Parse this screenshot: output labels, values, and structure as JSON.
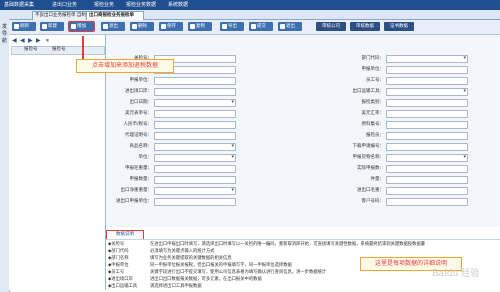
{
  "topbar": {
    "items": [
      "基础数据采集",
      "进出口业务",
      "报检业务",
      "报检业务数据",
      "系统数据"
    ]
  },
  "tabs": [
    {
      "label": "不良出口业务报检单 自制"
    },
    {
      "label": "出口商报检业务报检单"
    }
  ],
  "leftstrip": {
    "label1": "发",
    "label2": "导",
    "label3": "航"
  },
  "toolbar": {
    "buttons": [
      "刷新",
      "新建",
      "增加",
      "退出",
      "删除",
      "保存",
      "复制",
      "导出",
      "提交",
      "退出",
      "审核公司",
      "审核数据",
      "证书数据"
    ]
  },
  "list": {
    "nav": [
      "◀",
      "◀",
      "▶",
      "▶",
      "⏸"
    ],
    "col1": "报检号",
    "col2": "报检号"
  },
  "form": {
    "left_labels": [
      "关检号：",
      "部门名称：",
      "申报单位：",
      "进出境口岸：",
      "出口日期：",
      "美元表单号：",
      "人民币/税号：",
      "代理证明号：",
      "商品名称：",
      "单位：",
      "申报毛重量：",
      "申报数量：",
      "出口净重重量：",
      "进出口申报单位："
    ],
    "right_labels": [
      "部门代码：",
      "申报单位：",
      "员工号：",
      "出口运输工具：",
      "报检类别：",
      "美元汇率：",
      "原料集号：",
      "报检员：",
      "下载申请编号：",
      "申报货物名称：",
      "实际申报数：",
      "件量：",
      "进出口毛重：",
      "客户号码："
    ]
  },
  "section": {
    "title": "数据说明"
  },
  "notes": [
    {
      "label": "◆关检号",
      "text": "在进出口申报出口时填写，请选择出口时填写以一关检的唯一编码，重新取消即开始，可直接填写关键性数据，系统最终结束则关键数据按数据量"
    },
    {
      "label": "◆部门代码",
      "text": "必须填写为关键点输入的统计方式"
    },
    {
      "label": "◆部门名称",
      "text": "填写为业务关键提取的关键数据的相关信息"
    },
    {
      "label": "◆申报单位",
      "text": "同一申报单位报关报税，但出口报关的申报填写字，同一申报单位选择数据"
    },
    {
      "label": "◆员工号",
      "text": "关键字段进行出口不提交填写，使用公司信息表格为填写确认进行查询信息，进一步数据统计"
    },
    {
      "label": "◆进出境口岸",
      "text": "进出口出口数据报关数据，可多元素，在出口报关中的数据"
    },
    {
      "label": "◆出口运输工具",
      "text": "请选择进出口工具申报数据"
    }
  ],
  "callouts": {
    "add": "点击增加来添加退税数据",
    "note": "这里是每项数据的详细说明"
  },
  "watermark": "Baidu 经验",
  "colors": {
    "topbar": "#1f4f91",
    "accent": "#e23c3c",
    "callout_border": "#f0a43a",
    "toolbar_btn": "#3e6fb0"
  }
}
